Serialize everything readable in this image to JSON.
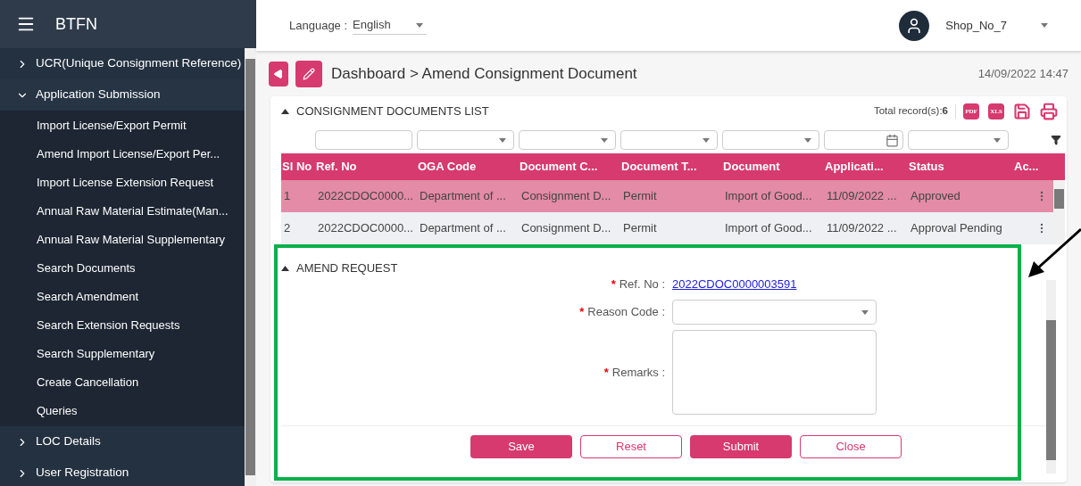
{
  "app": {
    "title": "BTFN"
  },
  "sidebar": {
    "items": [
      {
        "label": "UCR(Unique Consignment Reference)",
        "expanded": false
      },
      {
        "label": "Application Submission",
        "expanded": true,
        "children": [
          {
            "label": "Import License/Export Permit"
          },
          {
            "label": "Amend Import License/Export Per..."
          },
          {
            "label": "Import License Extension Request"
          },
          {
            "label": "Annual Raw Material Estimate(Man..."
          },
          {
            "label": "Annual Raw Material Supplementary"
          },
          {
            "label": "Search Documents"
          },
          {
            "label": "Search Amendment"
          },
          {
            "label": "Search Extension Requests"
          },
          {
            "label": "Search Supplementary"
          },
          {
            "label": "Create Cancellation"
          },
          {
            "label": "Queries"
          }
        ]
      },
      {
        "label": "LOC Details",
        "expanded": false
      },
      {
        "label": "User Registration",
        "expanded": false
      }
    ]
  },
  "topbar": {
    "language_label": "Language :",
    "language_value": "English",
    "user": "Shop_No_7"
  },
  "breadcrumb": "Dashboard > Amend Consignment Document",
  "datetime": "14/09/2022 14:47",
  "documents_list": {
    "title": "CONSIGNMENT DOCUMENTS LIST",
    "total_label": "Total record(s):",
    "total_value": "6",
    "export_buttons": [
      {
        "kind": "pdf",
        "label": "PDF"
      },
      {
        "kind": "xls",
        "label": "XLS"
      },
      {
        "kind": "save"
      },
      {
        "kind": "print"
      }
    ],
    "filters": [
      {
        "kind": "none"
      },
      {
        "kind": "text"
      },
      {
        "kind": "select"
      },
      {
        "kind": "select"
      },
      {
        "kind": "select"
      },
      {
        "kind": "select"
      },
      {
        "kind": "date"
      },
      {
        "kind": "select"
      }
    ],
    "columns": [
      "Sl No",
      "Ref. No",
      "OGA Code",
      "Document C...",
      "Document T...",
      "Document",
      "Applicati...",
      "Status",
      "Ac..."
    ],
    "rows": [
      {
        "selected": true,
        "cells": [
          "1",
          "2022CDOC0000...",
          "Department of ...",
          "Consignment D...",
          "Permit",
          "Import of Good...",
          "11/09/2022 ...",
          "Approved"
        ]
      },
      {
        "selected": false,
        "cells": [
          "2",
          "2022CDOC0000...",
          "Department of ...",
          "Consignment D...",
          "Permit",
          "Import of Good...",
          "11/09/2022 ...",
          "Approval Pending"
        ]
      }
    ]
  },
  "amend_request": {
    "title": "AMEND REQUEST",
    "fields": [
      {
        "kind": "link",
        "label": "Ref. No :",
        "required_mark": "*",
        "value": "2022CDOC0000003591"
      },
      {
        "kind": "select",
        "label": "Reason Code :",
        "required_mark": "*"
      },
      {
        "kind": "textarea",
        "label": "Remarks :",
        "required_mark": "*"
      }
    ],
    "buttons": [
      {
        "label": "Save",
        "kind": "primary"
      },
      {
        "label": "Reset",
        "kind": "outline"
      },
      {
        "label": "Submit",
        "kind": "primary"
      },
      {
        "label": "Close",
        "kind": "outline"
      }
    ]
  }
}
